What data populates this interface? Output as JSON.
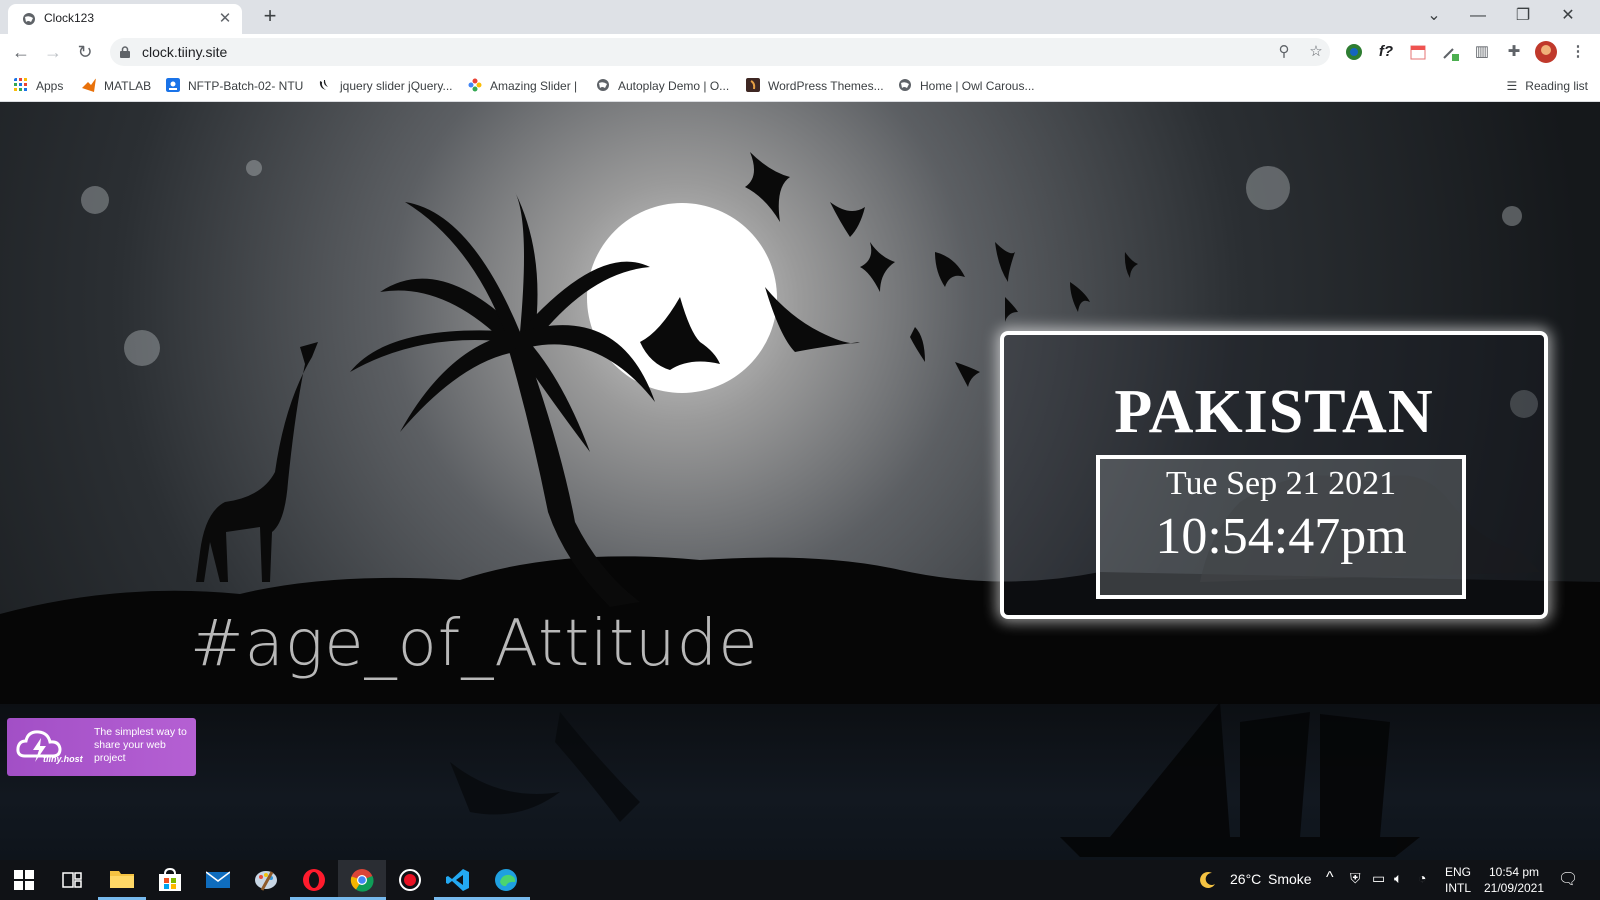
{
  "browser": {
    "tab_title": "Clock123",
    "url": "clock.tiiny.site",
    "bookmarks": [
      {
        "label": "Apps",
        "icon": "apps-grid-icon"
      },
      {
        "label": "MATLAB",
        "icon": "matlab-icon"
      },
      {
        "label": "NFTP-Batch-02- NTU",
        "icon": "classroom-icon"
      },
      {
        "label": "jquery slider jQuery...",
        "icon": "jquery-icon"
      },
      {
        "label": "Amazing Slider |",
        "icon": "amazing-slider-icon"
      },
      {
        "label": "Autoplay Demo | O...",
        "icon": "globe-icon"
      },
      {
        "label": "WordPress Themes...",
        "icon": "themeforest-icon"
      },
      {
        "label": "Home | Owl Carous...",
        "icon": "globe-icon"
      }
    ],
    "reading_list": "Reading list"
  },
  "page": {
    "country": "PAKISTAN",
    "date": "Tue Sep 21 2021",
    "time": "10:54:47pm",
    "hashtag": "#age_of_Attitude",
    "badge_brand": "tiiny.host",
    "badge_text": "The simplest way to share your web project"
  },
  "taskbar": {
    "apps": [
      "windows-start-icon",
      "task-view-icon",
      "file-explorer-icon",
      "microsoft-store-icon",
      "mail-icon",
      "paint-icon",
      "opera-icon",
      "chrome-icon",
      "recorder-icon",
      "vscode-icon",
      "edge-icon"
    ],
    "weather_temp": "26°C",
    "weather_desc": "Smoke",
    "lang_line1": "ENG",
    "lang_line2": "INTL",
    "clock_time": "10:54 pm",
    "clock_date": "21/09/2021"
  }
}
